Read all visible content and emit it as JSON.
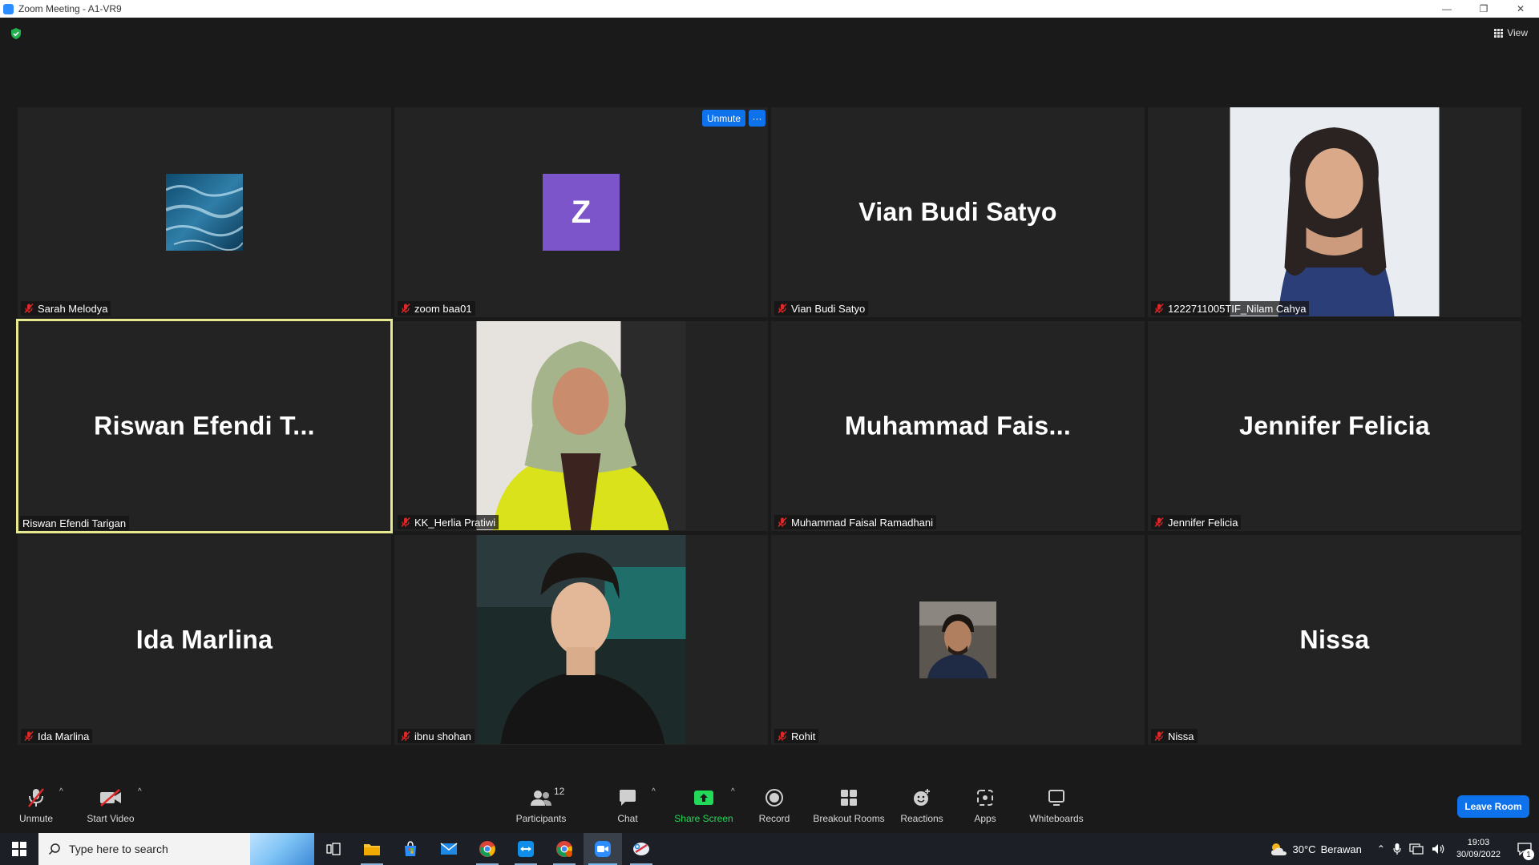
{
  "window": {
    "title": "Zoom Meeting - A1-VR9"
  },
  "header": {
    "view_label": "View"
  },
  "participants": [
    {
      "name": "Sarah Melodya",
      "muted": true,
      "display": "avatar-image"
    },
    {
      "name": "zoom baa01",
      "muted": true,
      "display": "initial",
      "initial": "Z",
      "initial_color": "#7b55c9",
      "hover_controls": {
        "unmute": "Unmute",
        "more": "···"
      }
    },
    {
      "name": "Vian Budi Satyo",
      "big_name": "Vian Budi Satyo",
      "muted": true,
      "display": "name"
    },
    {
      "name": "1222711005TIF_Nilam Cahya",
      "muted": true,
      "display": "video"
    },
    {
      "name": "Riswan Efendi Tarigan",
      "big_name": "Riswan Efendi T...",
      "muted": false,
      "display": "name",
      "active_speaker": true
    },
    {
      "name": "KK_Herlia Pratiwi",
      "muted": true,
      "display": "video"
    },
    {
      "name": "Muhammad Faisal Ramadhani",
      "big_name": "Muhammad  Fais...",
      "muted": true,
      "display": "name"
    },
    {
      "name": "Jennifer Felicia",
      "big_name": "Jennifer Felicia",
      "muted": true,
      "display": "name"
    },
    {
      "name": "Ida Marlina",
      "big_name": "Ida Marlina",
      "muted": true,
      "display": "name"
    },
    {
      "name": "ibnu shohan",
      "muted": true,
      "display": "video"
    },
    {
      "name": "Rohit",
      "muted": true,
      "display": "avatar-image"
    },
    {
      "name": "Nissa",
      "big_name": "Nissa",
      "muted": true,
      "display": "name"
    }
  ],
  "toolbar": {
    "unmute": "Unmute",
    "start_video": "Start Video",
    "participants": "Participants",
    "participants_count": "12",
    "chat": "Chat",
    "share_screen": "Share Screen",
    "record": "Record",
    "breakout_rooms": "Breakout Rooms",
    "reactions": "Reactions",
    "apps": "Apps",
    "whiteboards": "Whiteboards",
    "leave_room": "Leave Room"
  },
  "taskbar": {
    "search_placeholder": "Type here to search",
    "weather_temp": "30°C",
    "weather_desc": "Berawan",
    "time": "19:03",
    "date": "30/09/2022",
    "notification_count": "1"
  },
  "colors": {
    "accent": "#0e72ed",
    "active_speaker": "#e6e98f",
    "share_green": "#23d959",
    "muted_red": "#e02828"
  }
}
